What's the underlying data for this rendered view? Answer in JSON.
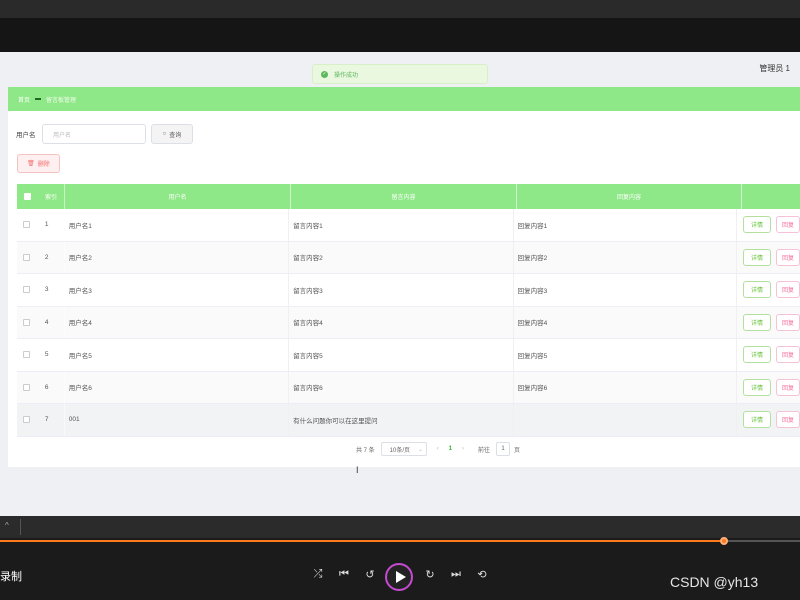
{
  "toast": {
    "message": "操作成功"
  },
  "header": {
    "user": "管理员 1"
  },
  "breadcrumb": {
    "home": "首页",
    "current": "留言板管理"
  },
  "search": {
    "label": "用户名",
    "placeholder": "用户名",
    "button": "查询"
  },
  "toolbar": {
    "delete_label": "删除"
  },
  "table": {
    "columns": [
      "索引",
      "用户名",
      "留言内容",
      "回复内容",
      ""
    ],
    "rows": [
      {
        "index": "1",
        "username": "用户名1",
        "message": "留言内容1",
        "reply": "回复内容1"
      },
      {
        "index": "2",
        "username": "用户名2",
        "message": "留言内容2",
        "reply": "回复内容2"
      },
      {
        "index": "3",
        "username": "用户名3",
        "message": "留言内容3",
        "reply": "回复内容3"
      },
      {
        "index": "4",
        "username": "用户名4",
        "message": "留言内容4",
        "reply": "回复内容4"
      },
      {
        "index": "5",
        "username": "用户名5",
        "message": "留言内容5",
        "reply": "回复内容5"
      },
      {
        "index": "6",
        "username": "用户名6",
        "message": "留言内容6",
        "reply": "回复内容6"
      },
      {
        "index": "7",
        "username": "001",
        "message": "有什么问题你可以在这里提问",
        "reply": ""
      }
    ],
    "actions": {
      "detail": "详情",
      "reply": "回复"
    }
  },
  "pager": {
    "total": "共 7 条",
    "page_size": "10条/页",
    "prev": "‹",
    "current_page": "1",
    "next": "›",
    "goto_label": "前往",
    "goto_value": "1",
    "unit": "页"
  },
  "player": {
    "record_label": "录制",
    "watermark": "CSDN @yh13",
    "progress": 0.905,
    "colors": {
      "accent": "#ff7a1a",
      "ring": "#c44ad0"
    },
    "icons": [
      "shuffle-icon",
      "skip-back-icon",
      "rewind-10-icon",
      "play-icon",
      "forward-30-icon",
      "skip-forward-icon",
      "repeat-off-icon"
    ]
  },
  "colors": {
    "brand_green": "#8fe887",
    "success": "#67c23a",
    "danger": "#f56c6c"
  }
}
